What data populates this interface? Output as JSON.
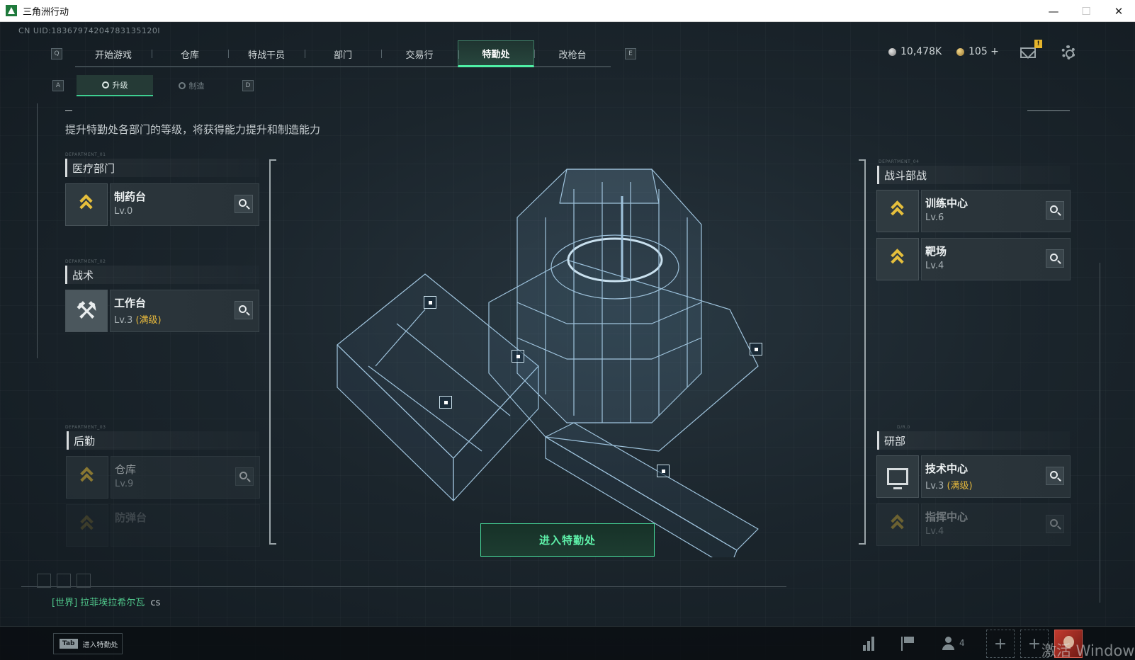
{
  "window": {
    "title": "三角洲行动",
    "minimize": "—",
    "maximize": "☐",
    "close": "✕"
  },
  "uid": "CN UID:18367974204783135120l",
  "nav": {
    "left_key": "Q",
    "right_key": "E",
    "tabs": [
      "开始游戏",
      "仓库",
      "特战干员",
      "部门",
      "交易行",
      "特勤处",
      "改枪台"
    ],
    "active_index": 5
  },
  "currency": {
    "silver": "10,478K",
    "gold": "105 +"
  },
  "mail_badge": "!",
  "subtabs": {
    "left_key": "A",
    "right_key": "D",
    "items": [
      "升级",
      "制造"
    ],
    "active_index": 0
  },
  "description": "提升特勤处各部门的等级，将获得能力提升和制造能力",
  "departments": {
    "medical": {
      "code": "DEPARTMENT_01",
      "title": "医疗部门",
      "items": [
        {
          "name": "制药台",
          "level": "Lv.0",
          "icon": "chevrons-icon"
        }
      ]
    },
    "tactics": {
      "code": "DEPARTMENT_02",
      "title": "战术",
      "items": [
        {
          "name": "工作台",
          "level": "Lv.3",
          "maxed": "(满级)",
          "icon": "hammer-wrench-icon"
        }
      ]
    },
    "logistics": {
      "code": "DEPARTMENT_03",
      "title": "后勤",
      "items": [
        {
          "name": "仓库",
          "level": "Lv.9",
          "icon": "chevrons-icon"
        },
        {
          "name": "防弹台",
          "level": "",
          "icon": "chevrons-icon"
        }
      ]
    },
    "combat": {
      "code": "DEPARTMENT_04",
      "title": "战斗部战",
      "items": [
        {
          "name": "训练中心",
          "level": "Lv.6",
          "icon": "chevrons-icon"
        },
        {
          "name": "靶场",
          "level": "Lv.4",
          "icon": "chevrons-icon"
        }
      ]
    },
    "research": {
      "code": "D/R.0",
      "title": "研部",
      "items": [
        {
          "name": "技术中心",
          "level": "Lv.3",
          "maxed": "(满级)",
          "icon": "monitor-icon"
        },
        {
          "name": "指挥中心",
          "level": "Lv.4",
          "icon": "chevrons-icon"
        }
      ]
    }
  },
  "enter_button": "进入特勤处",
  "chat": {
    "channel": "[世界]",
    "sender": "拉菲埃拉希尔瓦",
    "message": "cs"
  },
  "bottom": {
    "tab_key": "Tab",
    "tab_label": "进入特勤处",
    "friends_count": "4",
    "plus": "+",
    "watermark": "激活 Windows"
  },
  "colors": {
    "accent_green": "#4ff0a6",
    "maxed_gold": "#e4b73c",
    "chevron_gold": "#e6bf3c"
  }
}
